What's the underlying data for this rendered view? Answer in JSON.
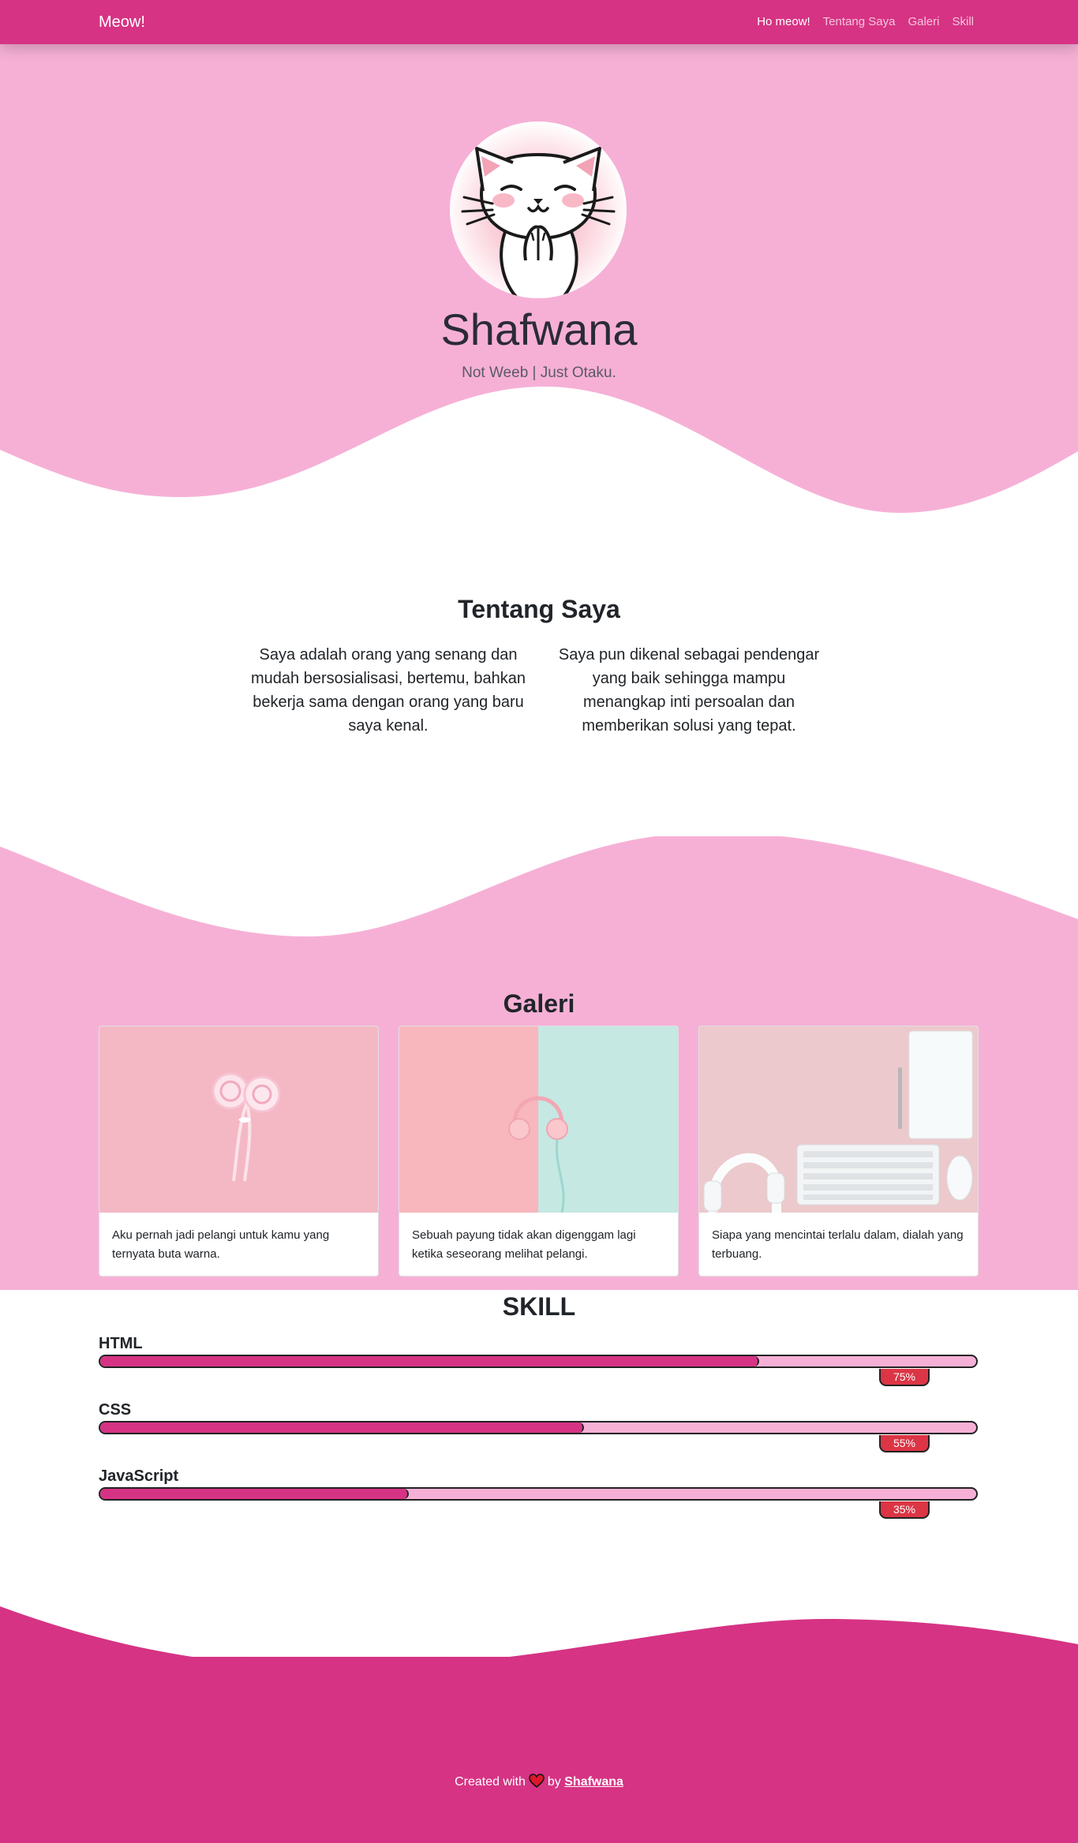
{
  "navbar": {
    "brand": "Meow!",
    "links": [
      {
        "label": "Ho meow!",
        "active": true
      },
      {
        "label": "Tentang Saya",
        "active": false
      },
      {
        "label": "Galeri",
        "active": false
      },
      {
        "label": "Skill",
        "active": false
      }
    ]
  },
  "hero": {
    "name": "Shafwana",
    "tagline": "Not Weeb | Just Otaku."
  },
  "about": {
    "title": "Tentang Saya",
    "paragraphs": [
      "Saya adalah orang yang senang dan mudah bersosialisasi, bertemu, bahkan bekerja sama dengan orang yang baru saya kenal.",
      "Saya pun dikenal sebagai pendengar yang baik sehingga mampu menangkap inti persoalan dan memberikan solusi yang tepat."
    ]
  },
  "gallery": {
    "title": "Galeri",
    "cards": [
      {
        "caption": "Aku pernah jadi pelangi untuk kamu yang ternyata buta warna.",
        "image": "lollipops-photo"
      },
      {
        "caption": "Sebuah payung tidak akan digenggam lagi ketika seseorang melihat pelangi.",
        "image": "headphones-photo"
      },
      {
        "caption": "Siapa yang mencintai terlalu dalam, dialah yang terbuang.",
        "image": "desk-keyboard-photo"
      }
    ]
  },
  "skill": {
    "title": "SKILL",
    "items": [
      {
        "label": "HTML",
        "percent": 75,
        "badge": "75%"
      },
      {
        "label": "CSS",
        "percent": 55,
        "badge": "55%"
      },
      {
        "label": "JavaScript",
        "percent": 35,
        "badge": "35%"
      }
    ]
  },
  "footer": {
    "prefix": "Created with",
    "by": "by",
    "author": "Shafwana"
  },
  "colors": {
    "primary": "#d63384",
    "light_pink": "#f6b0d6",
    "badge_red": "#dc3545"
  }
}
